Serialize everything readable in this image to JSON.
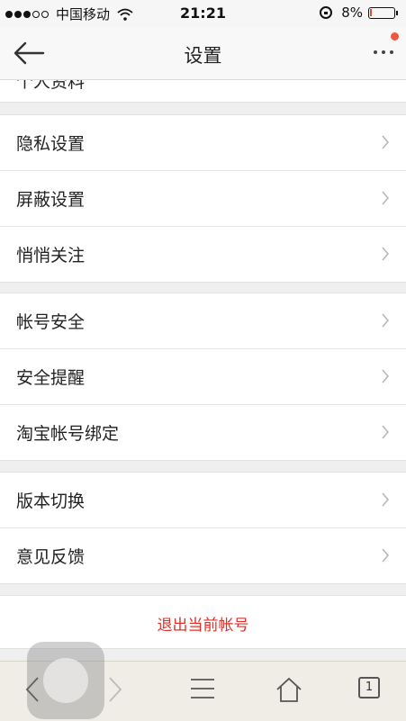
{
  "status_bar": {
    "carrier": "中国移动",
    "time": "21:21",
    "battery_percent": "8%",
    "battery_level": 0.08
  },
  "nav": {
    "title": "设置"
  },
  "partial_item": "个人资料",
  "groups": [
    {
      "items": [
        "隐私设置",
        "屏蔽设置",
        "悄悄关注"
      ]
    },
    {
      "items": [
        "帐号安全",
        "安全提醒",
        "淘宝帐号绑定"
      ]
    },
    {
      "items": [
        "版本切换",
        "意见反馈"
      ]
    }
  ],
  "logout_label": "退出当前帐号",
  "toolbar": {
    "tab_count": "1"
  },
  "colors": {
    "accent_red": "#e0302a",
    "badge": "#f2543c"
  }
}
